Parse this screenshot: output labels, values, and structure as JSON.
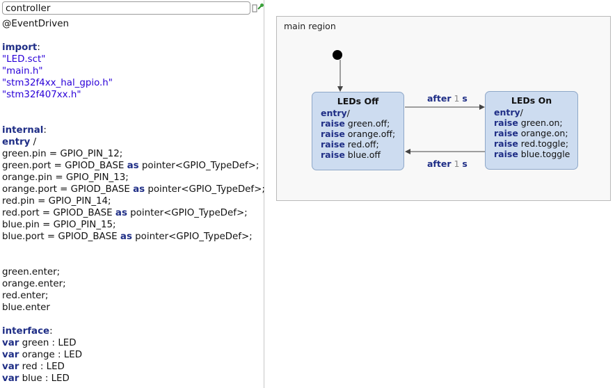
{
  "editor": {
    "name_value": "controller",
    "lines": [
      [
        {
          "t": "@EventDriven",
          "c": ""
        }
      ],
      [],
      [
        {
          "t": "import",
          "c": "kw"
        },
        {
          "t": ":",
          "c": ""
        }
      ],
      [
        {
          "t": "\"LED.sct\"",
          "c": "str"
        }
      ],
      [
        {
          "t": "\"main.h\"",
          "c": "str"
        }
      ],
      [
        {
          "t": "\"stm32f4xx_hal_gpio.h\"",
          "c": "str"
        }
      ],
      [
        {
          "t": "\"stm32f407xx.h\"",
          "c": "str"
        }
      ],
      [],
      [],
      [
        {
          "t": "internal",
          "c": "kw"
        },
        {
          "t": ":",
          "c": ""
        }
      ],
      [
        {
          "t": "entry",
          "c": "kw"
        },
        {
          "t": " /",
          "c": ""
        }
      ],
      [
        {
          "t": "green.pin = GPIO_PIN_12;",
          "c": ""
        }
      ],
      [
        {
          "t": "green.port = GPIOD_BASE ",
          "c": ""
        },
        {
          "t": "as",
          "c": "kw"
        },
        {
          "t": " pointer<GPIO_TypeDef>;",
          "c": ""
        }
      ],
      [
        {
          "t": "orange.pin = GPIO_PIN_13;",
          "c": ""
        }
      ],
      [
        {
          "t": "orange.port = GPIOD_BASE ",
          "c": ""
        },
        {
          "t": "as",
          "c": "kw"
        },
        {
          "t": " pointer<GPIO_TypeDef>;",
          "c": ""
        }
      ],
      [
        {
          "t": "red.pin = GPIO_PIN_14;",
          "c": ""
        }
      ],
      [
        {
          "t": "red.port = GPIOD_BASE ",
          "c": ""
        },
        {
          "t": "as",
          "c": "kw"
        },
        {
          "t": " pointer<GPIO_TypeDef>;",
          "c": ""
        }
      ],
      [
        {
          "t": "blue.pin = GPIO_PIN_15;",
          "c": ""
        }
      ],
      [
        {
          "t": "blue.port = GPIOD_BASE ",
          "c": ""
        },
        {
          "t": "as",
          "c": "kw"
        },
        {
          "t": " pointer<GPIO_TypeDef>;",
          "c": ""
        }
      ],
      [],
      [],
      [
        {
          "t": "green.enter;",
          "c": ""
        }
      ],
      [
        {
          "t": "orange.enter;",
          "c": ""
        }
      ],
      [
        {
          "t": "red.enter;",
          "c": ""
        }
      ],
      [
        {
          "t": "blue.enter",
          "c": ""
        }
      ],
      [],
      [
        {
          "t": "interface",
          "c": "kw"
        },
        {
          "t": ":",
          "c": ""
        }
      ],
      [
        {
          "t": "var",
          "c": "kw"
        },
        {
          "t": " green : LED",
          "c": ""
        }
      ],
      [
        {
          "t": "var",
          "c": "kw"
        },
        {
          "t": " orange : LED",
          "c": ""
        }
      ],
      [
        {
          "t": "var",
          "c": "kw"
        },
        {
          "t": " red : LED",
          "c": ""
        }
      ],
      [
        {
          "t": "var",
          "c": "kw"
        },
        {
          "t": " blue : LED",
          "c": ""
        }
      ]
    ]
  },
  "diagram": {
    "region_title": "main region",
    "states": {
      "off": {
        "name": "LEDs Off",
        "lines": [
          [
            {
              "t": "entry",
              "c": "kw"
            },
            {
              "t": "/",
              "c": ""
            }
          ],
          [
            {
              "t": "raise",
              "c": "kw"
            },
            {
              "t": " green.off;",
              "c": ""
            }
          ],
          [
            {
              "t": "raise",
              "c": "kw"
            },
            {
              "t": " orange.off;",
              "c": ""
            }
          ],
          [
            {
              "t": "raise",
              "c": "kw"
            },
            {
              "t": " red.off;",
              "c": ""
            }
          ],
          [
            {
              "t": "raise",
              "c": "kw"
            },
            {
              "t": " blue.off",
              "c": ""
            }
          ]
        ]
      },
      "on": {
        "name": "LEDs On",
        "lines": [
          [
            {
              "t": "entry",
              "c": "kw"
            },
            {
              "t": "/",
              "c": ""
            }
          ],
          [
            {
              "t": "raise",
              "c": "kw"
            },
            {
              "t": " green.on;",
              "c": ""
            }
          ],
          [
            {
              "t": "raise",
              "c": "kw"
            },
            {
              "t": " orange.on;",
              "c": ""
            }
          ],
          [
            {
              "t": "raise",
              "c": "kw"
            },
            {
              "t": " red.toggle;",
              "c": ""
            }
          ],
          [
            {
              "t": "raise",
              "c": "kw"
            },
            {
              "t": " blue.toggle",
              "c": ""
            }
          ]
        ]
      }
    },
    "transitions": [
      {
        "keyword": "after",
        "value": "1",
        "unit": "s"
      },
      {
        "keyword": "after",
        "value": "1",
        "unit": "s"
      }
    ]
  },
  "colors": {
    "keyword": "#1f2e86",
    "string": "#2a00d8",
    "state_fill": "#cddcf0",
    "state_border": "#8ea7c8",
    "diagram_bg": "#f8f8f8"
  },
  "icons": {
    "pin": "pin-icon"
  }
}
